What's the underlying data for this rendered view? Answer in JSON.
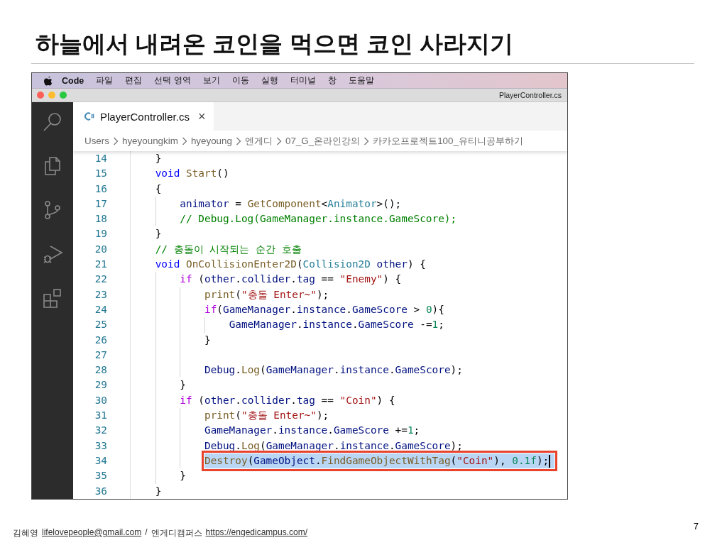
{
  "slide": {
    "title": "하늘에서 내려온 코인을 먹으면 코인 사라지기",
    "page_number": "7"
  },
  "window": {
    "menu": [
      {
        "label": "Code",
        "bold": true
      },
      {
        "label": "파일",
        "bold": false
      },
      {
        "label": "편집",
        "bold": false
      },
      {
        "label": "선택 영역",
        "bold": false
      },
      {
        "label": "보기",
        "bold": false
      },
      {
        "label": "이동",
        "bold": false
      },
      {
        "label": "실행",
        "bold": false
      },
      {
        "label": "터미널",
        "bold": false
      },
      {
        "label": "창",
        "bold": false
      },
      {
        "label": "도움말",
        "bold": false
      }
    ],
    "title": "PlayerController.cs",
    "tab": {
      "label": "PlayerController.cs",
      "close": "×",
      "selected": true
    },
    "breadcrumb": [
      "Users",
      "hyeyoungkim",
      "hyeyoung",
      "엔게디",
      "07_G_온라인강의",
      "카카오프로젝트100_유티니공부하기"
    ],
    "lines": [
      {
        "number": "14",
        "selected": false,
        "tokens": [
          {
            "t": "    }",
            "kind": "plain"
          }
        ]
      },
      {
        "number": "15",
        "selected": false,
        "tokens": [
          {
            "t": "    void",
            "kind": "kw"
          },
          {
            "t": " Start",
            "kind": "fn"
          },
          {
            "t": "()",
            "kind": "plain"
          }
        ]
      },
      {
        "number": "16",
        "selected": false,
        "tokens": [
          {
            "t": "    {",
            "kind": "plain"
          }
        ]
      },
      {
        "number": "17",
        "selected": false,
        "tokens": [
          {
            "t": "        animator",
            "kind": "var"
          },
          {
            "t": " = ",
            "kind": "plain"
          },
          {
            "t": "GetComponent",
            "kind": "fn"
          },
          {
            "t": "<",
            "kind": "plain"
          },
          {
            "t": "Animator",
            "kind": "type"
          },
          {
            "t": ">();",
            "kind": "plain"
          }
        ]
      },
      {
        "number": "18",
        "selected": false,
        "tokens": [
          {
            "t": "        // Debug.Log(GameManager.instance.GameScore);",
            "kind": "comment"
          }
        ]
      },
      {
        "number": "19",
        "selected": false,
        "tokens": [
          {
            "t": "    }",
            "kind": "plain"
          }
        ]
      },
      {
        "number": "20",
        "selected": false,
        "tokens": [
          {
            "t": "    // 충돌이 시작되는 순간 호출",
            "kind": "comment"
          }
        ]
      },
      {
        "number": "21",
        "selected": false,
        "tokens": [
          {
            "t": "    void",
            "kind": "kw"
          },
          {
            "t": " OnCollisionEnter2D",
            "kind": "fn"
          },
          {
            "t": "(",
            "kind": "plain"
          },
          {
            "t": "Collision2D",
            "kind": "type"
          },
          {
            "t": " other",
            "kind": "var"
          },
          {
            "t": ") {",
            "kind": "plain"
          }
        ]
      },
      {
        "number": "22",
        "selected": false,
        "tokens": [
          {
            "t": "        if",
            "kind": "ctrl"
          },
          {
            "t": " (",
            "kind": "plain"
          },
          {
            "t": "other",
            "kind": "var"
          },
          {
            "t": ".",
            "kind": "plain"
          },
          {
            "t": "collider",
            "kind": "var"
          },
          {
            "t": ".",
            "kind": "plain"
          },
          {
            "t": "tag",
            "kind": "var"
          },
          {
            "t": " == ",
            "kind": "plain"
          },
          {
            "t": "\"Enemy\"",
            "kind": "str"
          },
          {
            "t": ") {",
            "kind": "plain"
          }
        ]
      },
      {
        "number": "23",
        "selected": false,
        "tokens": [
          {
            "t": "            print",
            "kind": "fn"
          },
          {
            "t": "(",
            "kind": "plain"
          },
          {
            "t": "\"충돌 Enter~\"",
            "kind": "str"
          },
          {
            "t": ");",
            "kind": "plain"
          }
        ]
      },
      {
        "number": "24",
        "selected": false,
        "tokens": [
          {
            "t": "            if",
            "kind": "ctrl"
          },
          {
            "t": "(",
            "kind": "plain"
          },
          {
            "t": "GameManager",
            "kind": "var"
          },
          {
            "t": ".",
            "kind": "plain"
          },
          {
            "t": "instance",
            "kind": "var"
          },
          {
            "t": ".",
            "kind": "plain"
          },
          {
            "t": "GameScore",
            "kind": "var"
          },
          {
            "t": " > ",
            "kind": "plain"
          },
          {
            "t": "0",
            "kind": "num"
          },
          {
            "t": "){",
            "kind": "plain"
          }
        ]
      },
      {
        "number": "25",
        "selected": false,
        "tokens": [
          {
            "t": "                GameManager",
            "kind": "var"
          },
          {
            "t": ".",
            "kind": "plain"
          },
          {
            "t": "instance",
            "kind": "var"
          },
          {
            "t": ".",
            "kind": "plain"
          },
          {
            "t": "GameScore",
            "kind": "var"
          },
          {
            "t": " -=",
            "kind": "plain"
          },
          {
            "t": "1",
            "kind": "num"
          },
          {
            "t": ";",
            "kind": "plain"
          }
        ]
      },
      {
        "number": "26",
        "selected": false,
        "tokens": [
          {
            "t": "            }",
            "kind": "plain"
          }
        ]
      },
      {
        "number": "27",
        "selected": false
      },
      {
        "number": "28",
        "selected": false,
        "tokens": [
          {
            "t": "            Debug",
            "kind": "var"
          },
          {
            "t": ".",
            "kind": "plain"
          },
          {
            "t": "Log",
            "kind": "fn"
          },
          {
            "t": "(",
            "kind": "plain"
          },
          {
            "t": "GameManager",
            "kind": "var"
          },
          {
            "t": ".",
            "kind": "plain"
          },
          {
            "t": "instance",
            "kind": "var"
          },
          {
            "t": ".",
            "kind": "plain"
          },
          {
            "t": "GameScore",
            "kind": "var"
          },
          {
            "t": ");",
            "kind": "plain"
          }
        ]
      },
      {
        "number": "29",
        "selected": false,
        "tokens": [
          {
            "t": "        }",
            "kind": "plain"
          }
        ]
      },
      {
        "number": "30",
        "selected": false,
        "tokens": [
          {
            "t": "        if",
            "kind": "ctrl"
          },
          {
            "t": " (",
            "kind": "plain"
          },
          {
            "t": "other",
            "kind": "var"
          },
          {
            "t": ".",
            "kind": "plain"
          },
          {
            "t": "collider",
            "kind": "var"
          },
          {
            "t": ".",
            "kind": "plain"
          },
          {
            "t": "tag",
            "kind": "var"
          },
          {
            "t": " == ",
            "kind": "plain"
          },
          {
            "t": "\"Coin\"",
            "kind": "str"
          },
          {
            "t": ") {",
            "kind": "plain"
          }
        ]
      },
      {
        "number": "31",
        "selected": false,
        "tokens": [
          {
            "t": "            print",
            "kind": "fn"
          },
          {
            "t": "(",
            "kind": "plain"
          },
          {
            "t": "\"충돌 Enter~\"",
            "kind": "str"
          },
          {
            "t": ");",
            "kind": "plain"
          }
        ]
      },
      {
        "number": "32",
        "selected": false,
        "tokens": [
          {
            "t": "            GameManager",
            "kind": "var"
          },
          {
            "t": ".",
            "kind": "plain"
          },
          {
            "t": "instance",
            "kind": "var"
          },
          {
            "t": ".",
            "kind": "plain"
          },
          {
            "t": "GameScore",
            "kind": "var"
          },
          {
            "t": " +=",
            "kind": "plain"
          },
          {
            "t": "1",
            "kind": "num"
          },
          {
            "t": ";",
            "kind": "plain"
          }
        ]
      },
      {
        "number": "33",
        "selected": false,
        "tokens": [
          {
            "t": "            Debug",
            "kind": "var"
          },
          {
            "t": ".",
            "kind": "plain"
          },
          {
            "t": "Log",
            "kind": "fn"
          },
          {
            "t": "(",
            "kind": "plain"
          },
          {
            "t": "GameManager",
            "kind": "var"
          },
          {
            "t": ".",
            "kind": "plain"
          },
          {
            "t": "instance",
            "kind": "var"
          },
          {
            "t": ".",
            "kind": "plain"
          },
          {
            "t": "GameScore",
            "kind": "var"
          },
          {
            "t": ");",
            "kind": "plain"
          }
        ]
      },
      {
        "number": "34",
        "selected": true,
        "tokens": [
          {
            "t": "            Destroy",
            "kind": "fn"
          },
          {
            "t": "(",
            "kind": "plain"
          },
          {
            "t": "GameObject",
            "kind": "var"
          },
          {
            "t": ".",
            "kind": "plain"
          },
          {
            "t": "FindGameObjectWithTag",
            "kind": "fn"
          },
          {
            "t": "(",
            "kind": "plain"
          },
          {
            "t": "\"Coin\"",
            "kind": "str"
          },
          {
            "t": "), ",
            "kind": "plain"
          },
          {
            "t": "0.1f",
            "kind": "num"
          },
          {
            "t": ");",
            "kind": "plain"
          }
        ]
      },
      {
        "number": "35",
        "selected": false,
        "tokens": [
          {
            "t": "        }",
            "kind": "plain"
          }
        ]
      },
      {
        "number": "36",
        "selected": false,
        "tokens": [
          {
            "t": "    }",
            "kind": "plain"
          }
        ]
      }
    ]
  },
  "footer": {
    "author": "김혜영",
    "email": "lifelovepeople@gmail.com",
    "separator": "/",
    "org": "엔게디캠퍼스",
    "url": "https://engedicampus.com/"
  }
}
